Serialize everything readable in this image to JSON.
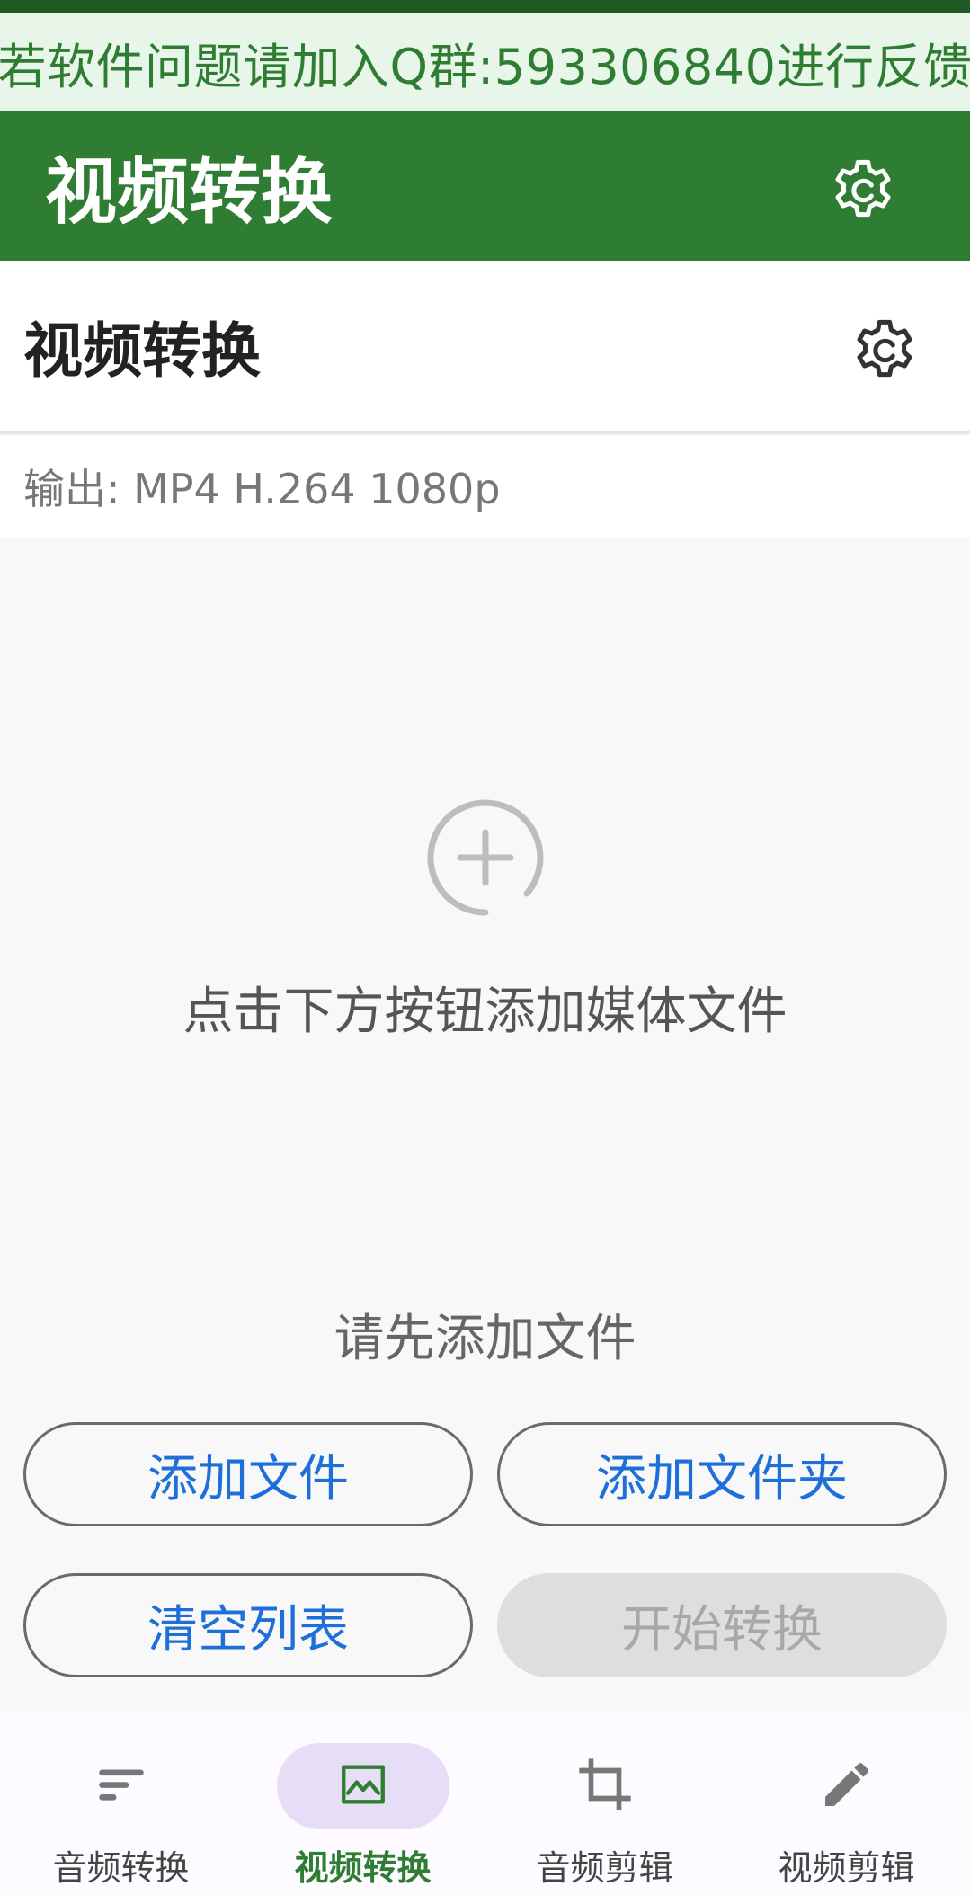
{
  "notice": {
    "text": "若软件问题请加入Q群:593306840进行反馈"
  },
  "appbar": {
    "title": "视频转换",
    "settings_icon": "gear-sync-icon"
  },
  "section": {
    "title": "视频转换",
    "settings_icon": "gear-sync-icon"
  },
  "output": {
    "label": "输出: MP4 H.264 1080p"
  },
  "empty_state": {
    "icon": "add-circle-icon",
    "hint": "点击下方按钮添加媒体文件",
    "status": "请先添加文件"
  },
  "actions": {
    "add_file": "添加文件",
    "add_folder": "添加文件夹",
    "clear_list": "清空列表",
    "start_convert": "开始转换"
  },
  "bottom_nav": {
    "items": [
      {
        "label": "音频转换",
        "icon": "sort-lines-icon",
        "active": false
      },
      {
        "label": "视频转换",
        "icon": "image-icon",
        "active": true
      },
      {
        "label": "音频剪辑",
        "icon": "crop-icon",
        "active": false
      },
      {
        "label": "视频剪辑",
        "icon": "pencil-icon",
        "active": false
      }
    ]
  },
  "colors": {
    "primary": "#2f7d32",
    "notice_bg": "#e8f5e9",
    "notice_text": "#2e7d32",
    "button_text": "#1e6fd9",
    "active_pill": "#e6ddf6"
  }
}
